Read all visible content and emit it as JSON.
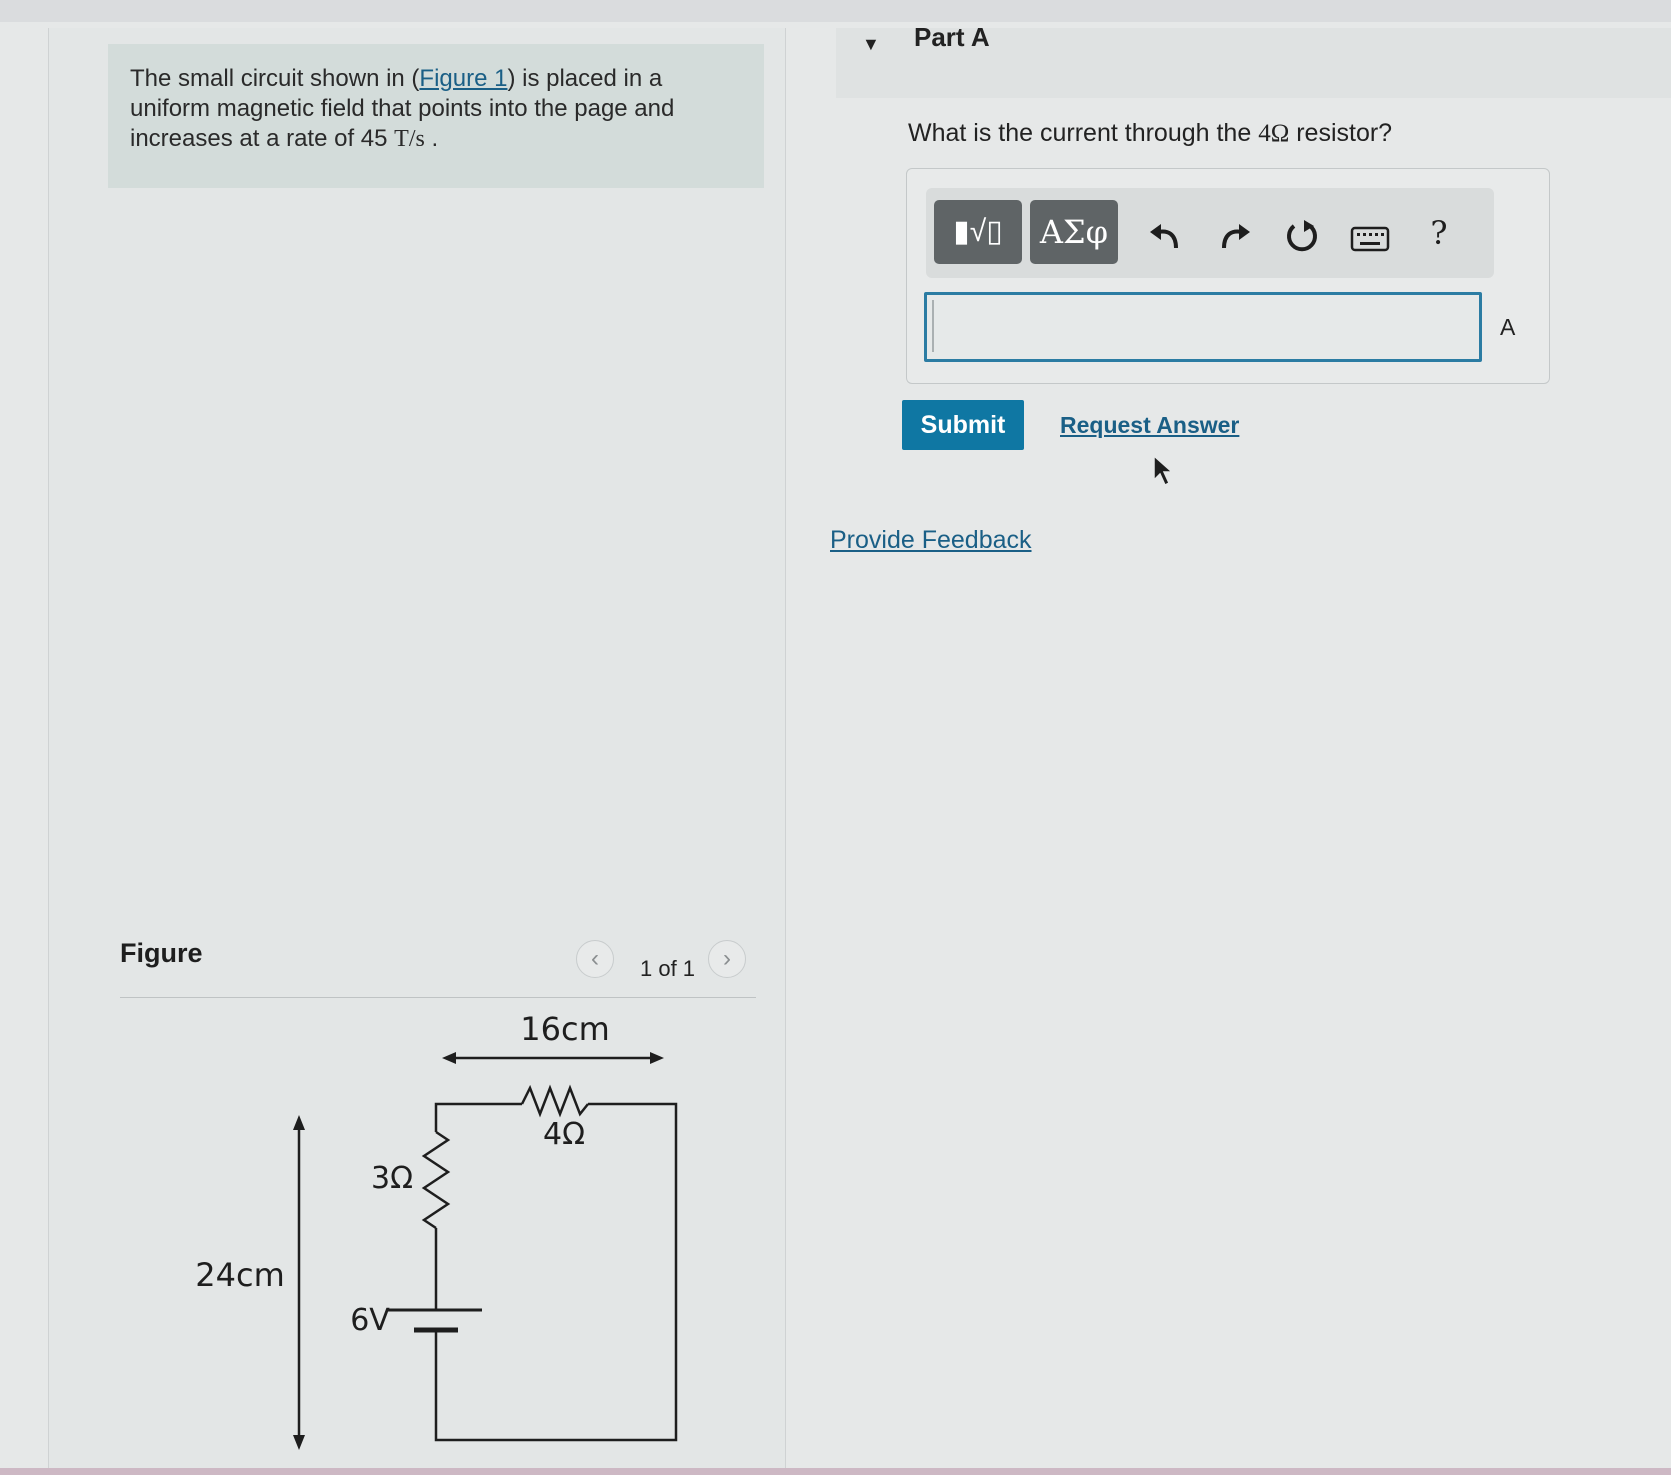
{
  "problem": {
    "intro": "The small circuit shown in (",
    "figure_link": "Figure 1",
    "rest": ") is placed in a uniform magnetic field that points into the page and increases at a rate of 45 ",
    "rate_unit": "T/s",
    "period": " ."
  },
  "figure": {
    "title": "Figure",
    "pager": "1 of 1",
    "prev_icon": "chevron-left-icon",
    "next_icon": "chevron-right-icon",
    "labels": {
      "width": "16cm",
      "height": "24cm",
      "r_top": "4Ω",
      "r_left": "3Ω",
      "battery": "6V"
    }
  },
  "part": {
    "title": "Part A",
    "question_pre": "What is the current through the ",
    "question_math": "4Ω",
    "question_post": " resistor?"
  },
  "toolbar": {
    "templates_label": "▮√▯",
    "greek_label": "ΑΣφ",
    "undo_icon": "undo-icon",
    "redo_icon": "redo-icon",
    "reset_icon": "reset-icon",
    "keyboard_icon": "keyboard-icon",
    "help_label": "?"
  },
  "answer": {
    "value": "",
    "unit": "A"
  },
  "actions": {
    "submit": "Submit",
    "request_answer": "Request Answer",
    "provide_feedback": "Provide Feedback"
  },
  "colors": {
    "accent": "#0f77a3",
    "link": "#1a5f86",
    "problem_bg": "#d3dcda"
  }
}
